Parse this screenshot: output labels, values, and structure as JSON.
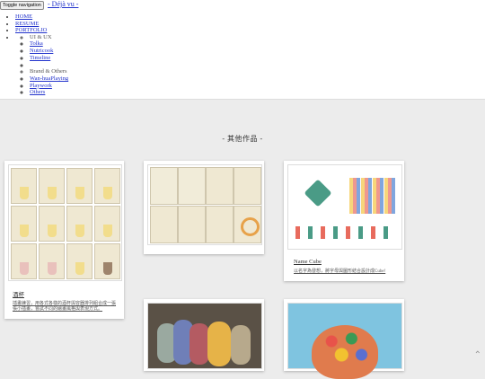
{
  "nav": {
    "toggle_label": "Toggle navigation",
    "brand": "- Déjà vu -",
    "items": [
      "HOME",
      "RESUME",
      "PORTFOLIO"
    ],
    "submenu": [
      "UI & UX",
      "Tolka",
      "Nutricook",
      "Timeline",
      "",
      "Brand & Others",
      "Wan-huaPlaying",
      "Playwork",
      "Others"
    ]
  },
  "section": {
    "title": "- 其他作品 -"
  },
  "cards": [
    {
      "title": "酒杯",
      "desc": "插畫練習，用各式各樣的酒杯與容器排列組合成一張張小插畫，嘗試不同的繪畫風格與表現方式。"
    },
    {
      "title": "",
      "desc": ""
    },
    {
      "title": "Name Cube",
      "desc": "以名字為發想，將字母與圖形結合設計成Cube!"
    }
  ],
  "icons": {
    "scroll_top": "chevron-up-icon"
  }
}
